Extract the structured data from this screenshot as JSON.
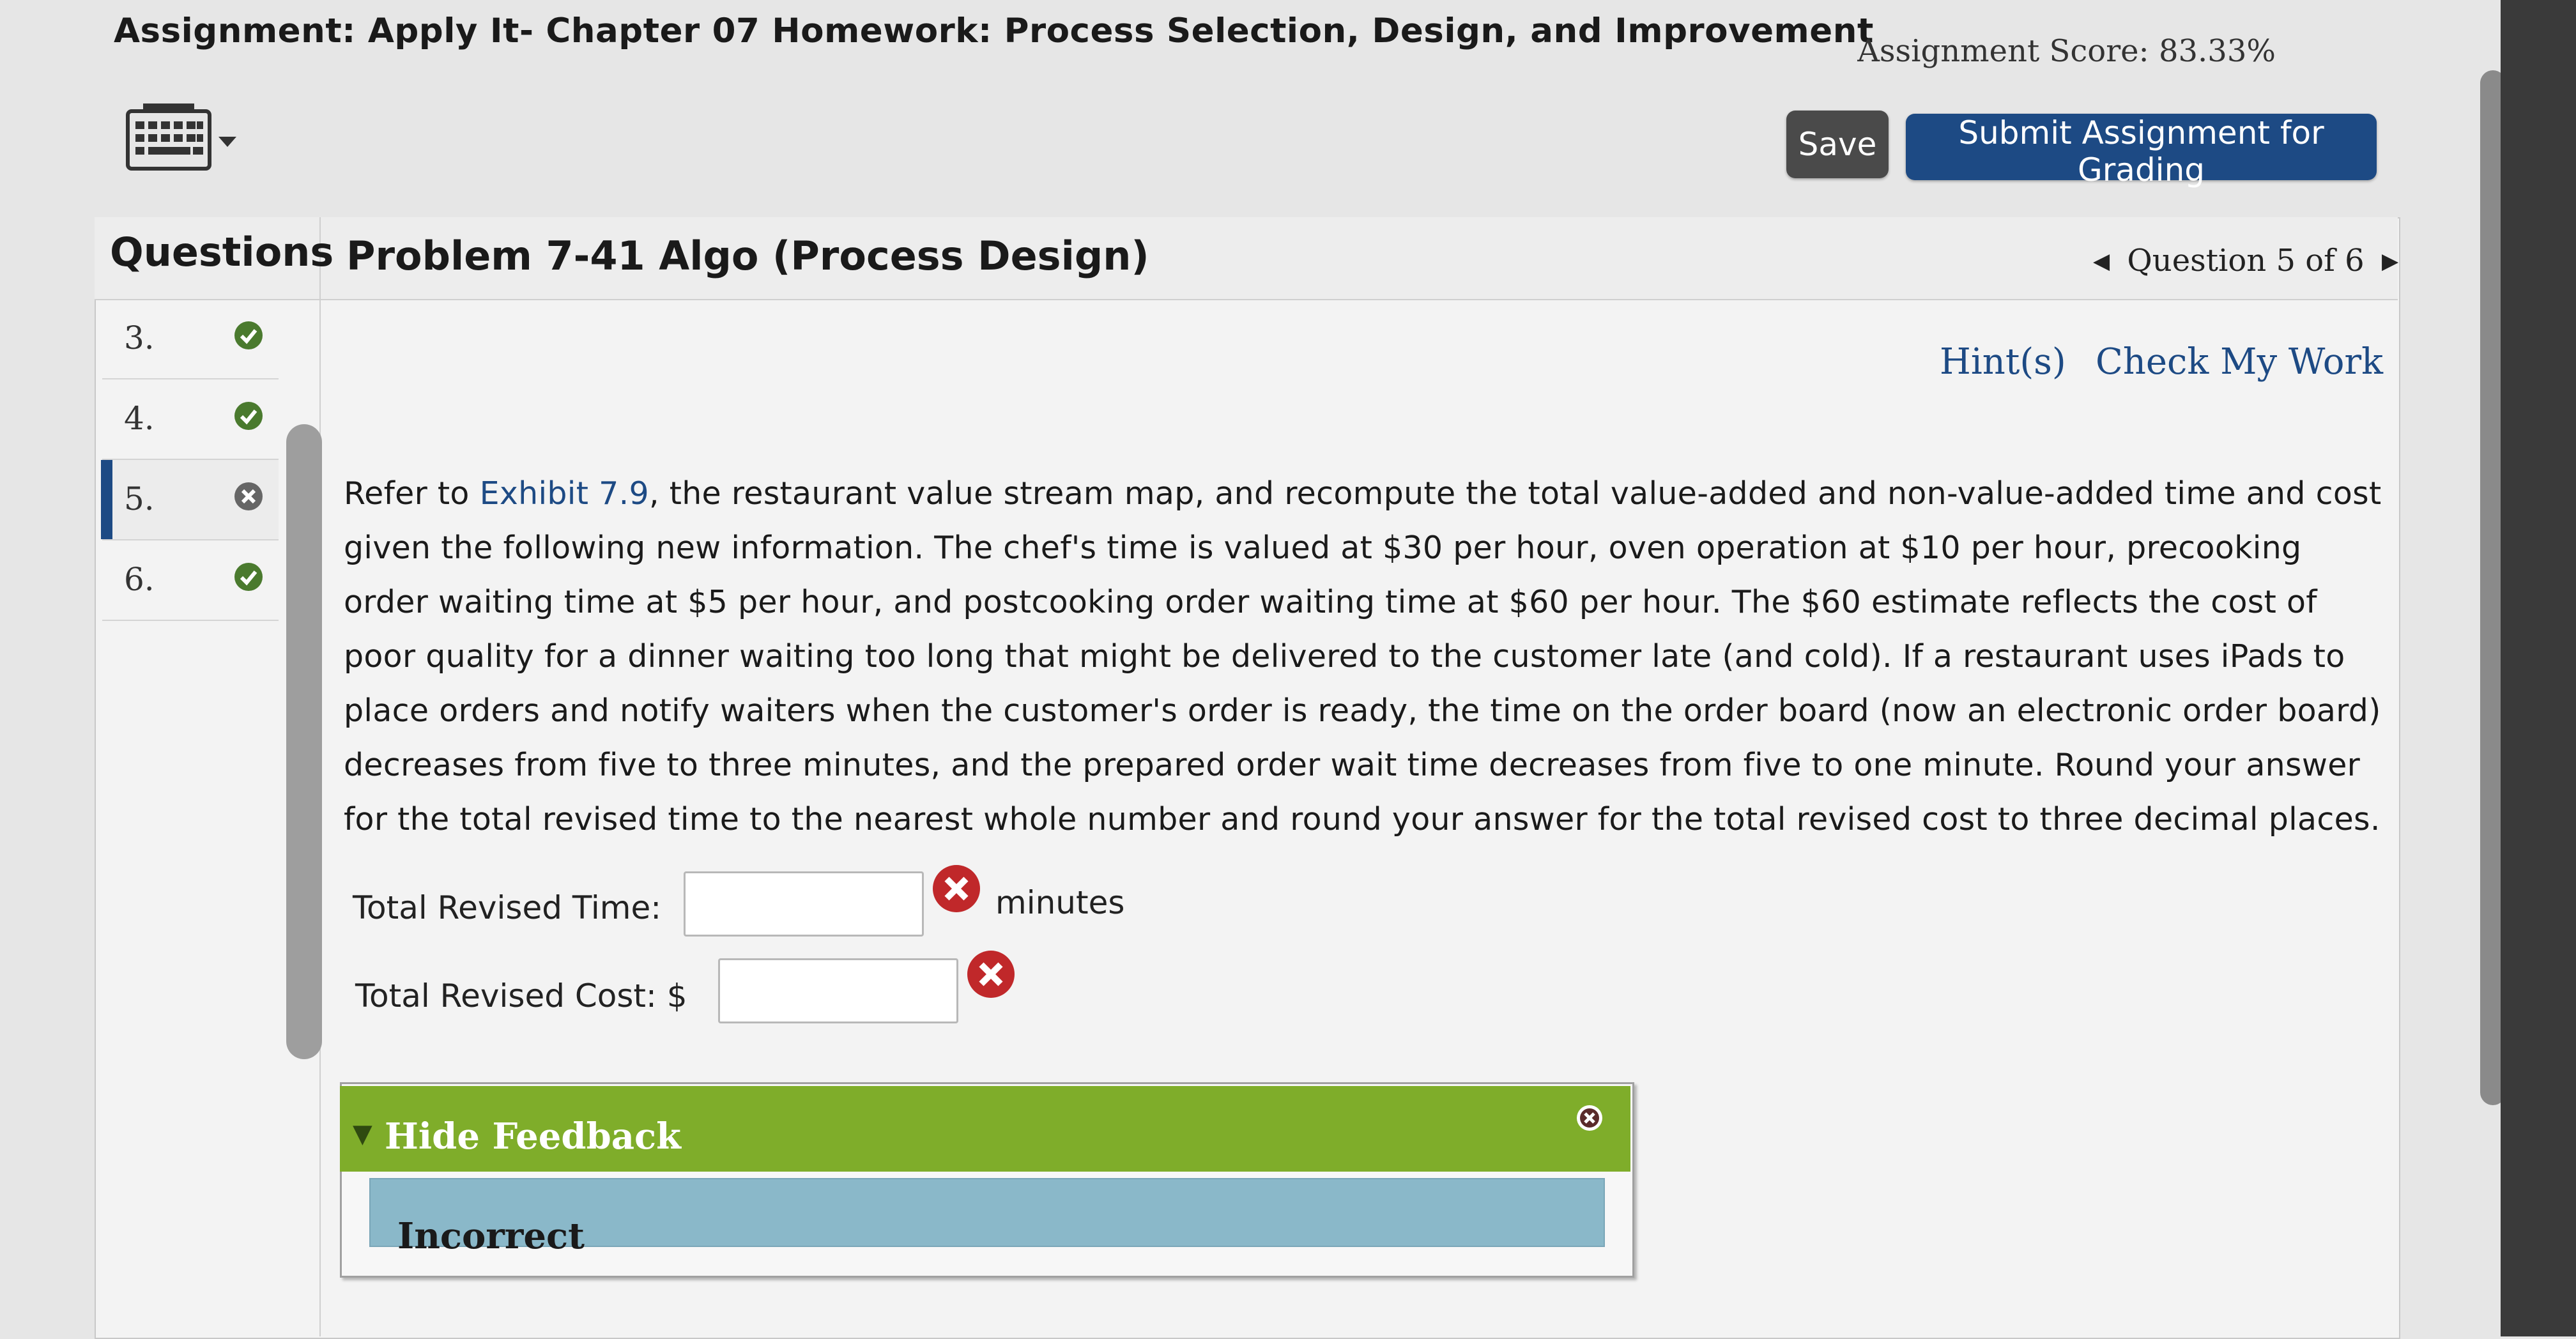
{
  "header": {
    "assignment_title": "Assignment: Apply It- Chapter 07 Homework: Process Selection, Design, and Improvement",
    "score": "Assignment Score: 83.33%",
    "save_label": "Save",
    "submit_label": "Submit Assignment for Grading"
  },
  "sidebar": {
    "title": "Questions",
    "items": [
      {
        "num": "3.",
        "status": "correct"
      },
      {
        "num": "4.",
        "status": "correct"
      },
      {
        "num": "5.",
        "status": "incorrect"
      },
      {
        "num": "6.",
        "status": "correct"
      }
    ]
  },
  "problem": {
    "title": "Problem 7-41 Algo (Process Design)",
    "nav": "Question 5 of 6",
    "hints_label": "Hint(s)",
    "check_label": "Check My Work",
    "text_before_link": "Refer to ",
    "link_text": "Exhibit 7.9",
    "text_after_link": ", the restaurant value stream map, and recompute the total value-added and non-value-added time and cost given the following new information. The chef's time is valued at $30 per hour, oven operation at $10 per hour, precooking order waiting time at $5 per hour, and postcooking order waiting time at $60 per hour. The $60 estimate reflects the cost of poor quality for a dinner waiting too long that might be delivered to the customer late (and cold). If a restaurant uses iPads to place orders and notify waiters when the customer's order is ready, the time on the order board (now an electronic order board) decreases from five to three minutes, and the prepared order wait time decreases from five to one minute. Round your answer for the total revised time to the nearest whole number and round your answer for the total revised cost to three decimal places.",
    "time_label": "Total Revised Time:",
    "time_value": "",
    "time_unit": "minutes",
    "cost_label": "Total Revised Cost: $",
    "cost_value": ""
  },
  "feedback": {
    "toggle_label": "Hide Feedback",
    "result": "Incorrect"
  },
  "colors": {
    "primary": "#1d4a84",
    "correct": "#4a7a2e",
    "incorrect": "#c0282a",
    "feedback_header": "#7fad2a",
    "feedback_result_bg": "#8ab8c9"
  },
  "icons": [
    "keyboard-icon",
    "caret-down-icon",
    "check-circle-icon",
    "x-circle-icon",
    "caret-left-icon",
    "caret-right-icon",
    "close-icon"
  ]
}
